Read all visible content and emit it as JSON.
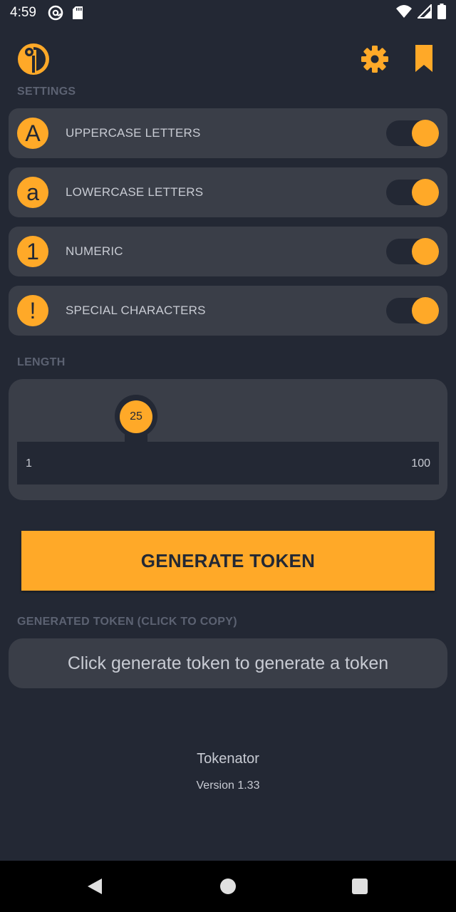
{
  "status_bar": {
    "time": "4:59",
    "icons": [
      "at-sign-icon",
      "sd-card-icon",
      "wifi-icon",
      "signal-icon",
      "battery-icon"
    ]
  },
  "app_bar": {
    "logo_icon": "tokenator-logo-icon",
    "actions": [
      "gear-icon",
      "bookmark-icon"
    ]
  },
  "colors": {
    "accent": "#ffa928",
    "background": "#232834",
    "card": "#3a3e48",
    "section_label": "#5c6272"
  },
  "settings": {
    "label": "SETTINGS",
    "items": [
      {
        "glyph": "A",
        "label": "UPPERCASE LETTERS",
        "enabled": true
      },
      {
        "glyph": "a",
        "label": "LOWERCASE LETTERS",
        "enabled": true
      },
      {
        "glyph": "1",
        "label": "NUMERIC",
        "enabled": true
      },
      {
        "glyph": "!",
        "label": "SPECIAL CHARACTERS",
        "enabled": true
      }
    ]
  },
  "length": {
    "label": "LENGTH",
    "value": "25",
    "min": "1",
    "max": "100"
  },
  "generate_button": {
    "label": "GENERATE TOKEN"
  },
  "token": {
    "label": "GENERATED TOKEN (CLICK TO COPY)",
    "placeholder": "Click generate token to generate a token"
  },
  "footer": {
    "app_name": "Tokenator",
    "version": "Version 1.33"
  },
  "nav_bar": {
    "buttons": [
      "back-icon",
      "home-icon",
      "recents-icon"
    ]
  }
}
